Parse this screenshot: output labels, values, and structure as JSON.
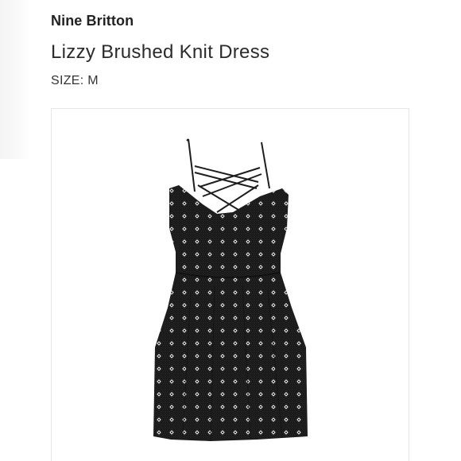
{
  "product": {
    "brand": "Nine Britton",
    "name": "Lizzy Brushed Knit Dress",
    "size_text": "SIZE: M"
  },
  "colors": {
    "dress": "#1d1d1d",
    "pattern": "#d9d9d9",
    "card_border": "#e6e6e6"
  },
  "image": {
    "subject": "black-patterned-spaghetti-strap-dress"
  }
}
